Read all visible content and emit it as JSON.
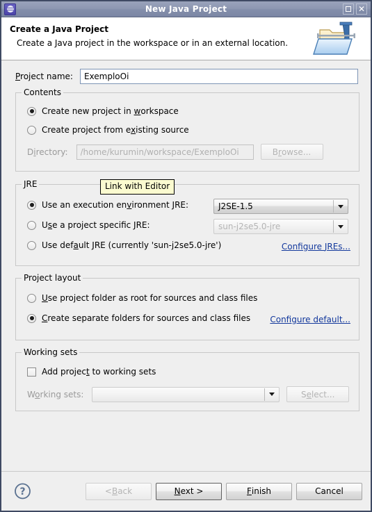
{
  "window": {
    "title": "New Java Project",
    "icon": "eclipse-icon",
    "maximize_label": "Maximize",
    "close_label": "Close"
  },
  "header": {
    "title": "Create a Java Project",
    "description": "Create a Java project in the workspace or in an external location.",
    "icon": "java-project-wizard-icon"
  },
  "project_name": {
    "label": "Project name:",
    "label_mnemonic": "P",
    "value": "ExemploOi"
  },
  "contents": {
    "group_title": "Contents",
    "options": [
      {
        "label_pre": "Create new project in ",
        "mnemonic": "w",
        "label_post": "orkspace",
        "checked": true,
        "enabled": true
      },
      {
        "label_pre": "Create project from e",
        "mnemonic": "x",
        "label_post": "isting source",
        "checked": false,
        "enabled": true
      }
    ],
    "directory": {
      "label_pre": "D",
      "label_mnemonic": "i",
      "label_post": "rectory:",
      "value": "/home/kurumin/workspace/ExemploOi",
      "enabled": false
    },
    "browse_button": {
      "label_pre": "B",
      "mnemonic": "r",
      "label_post": "owse...",
      "enabled": false
    }
  },
  "jre": {
    "group_title": "JRE",
    "options": [
      {
        "label_pre": "Use an execution en",
        "mnemonic": "v",
        "label_post": "ironment JRE:",
        "checked": true
      },
      {
        "label_pre": "U",
        "mnemonic": "s",
        "label_post": "e a project specific JRE:",
        "checked": false
      },
      {
        "label_pre": "Use def",
        "mnemonic": "a",
        "label_post": "ult JRE (currently 'sun-j2se5.0-jre')",
        "checked": false
      }
    ],
    "execution_env_combo": {
      "value": "J2SE-1.5",
      "enabled": true
    },
    "project_jre_combo": {
      "value": "sun-j2se5.0-jre",
      "enabled": false
    },
    "configure_link": {
      "pre": "Configure ",
      "mnemonic": "J",
      "post": "REs..."
    }
  },
  "project_layout": {
    "group_title": "Project layout",
    "options": [
      {
        "label_pre": "U",
        "mnemonic": "s",
        "label_post": "e project folder as root for sources and class files",
        "checked": false
      },
      {
        "label_pre": "",
        "mnemonic": "C",
        "label_post": "reate separate folders for sources and class files",
        "checked": true
      }
    ],
    "configure_link": {
      "pre": "Configure default..."
    }
  },
  "working_sets": {
    "group_title": "Working sets",
    "checkbox": {
      "label_pre": "Add projec",
      "mnemonic": "t",
      "label_post": " to working sets",
      "checked": false
    },
    "combo_label": {
      "pre": "W",
      "mnemonic": "o",
      "post": "rking sets:"
    },
    "combo_value": "",
    "select_button": {
      "pre": "S",
      "mnemonic": "e",
      "post": "lect..."
    }
  },
  "tooltip": {
    "text": "Link with Editor"
  },
  "footer": {
    "help_icon": "help-question-icon",
    "buttons": [
      {
        "name": "back",
        "pre": "< ",
        "mnemonic": "B",
        "post": "ack",
        "enabled": false,
        "default": false
      },
      {
        "name": "next",
        "pre": "",
        "mnemonic": "N",
        "post": "ext >",
        "enabled": true,
        "default": true
      },
      {
        "name": "finish",
        "pre": "",
        "mnemonic": "F",
        "post": "inish",
        "enabled": true,
        "default": false
      },
      {
        "name": "cancel",
        "pre": "Cancel",
        "mnemonic": "",
        "post": "",
        "enabled": true,
        "default": false
      }
    ]
  },
  "colors": {
    "titlebar": "#8d97b1",
    "background": "#efefef",
    "link": "#12389c",
    "tooltip_bg": "#fbfbd0",
    "border": "#3f4a63"
  }
}
